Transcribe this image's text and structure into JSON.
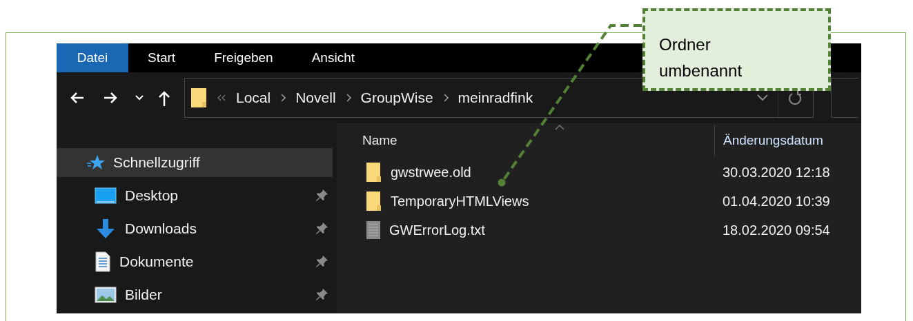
{
  "ribbon_tabs": [
    {
      "label": "Datei",
      "selected": true
    },
    {
      "label": "Start",
      "selected": false
    },
    {
      "label": "Freigeben",
      "selected": false
    },
    {
      "label": "Ansicht",
      "selected": false
    }
  ],
  "address_bar": {
    "path": [
      "Local",
      "Novell",
      "GroupWise",
      "meinradfink"
    ]
  },
  "sidebar": {
    "items": [
      {
        "label": "Schnellzugriff",
        "kind": "quick-access",
        "selected": true,
        "pinned": false
      },
      {
        "label": "Desktop",
        "kind": "desktop",
        "selected": false,
        "pinned": true
      },
      {
        "label": "Downloads",
        "kind": "downloads",
        "selected": false,
        "pinned": true
      },
      {
        "label": "Dokumente",
        "kind": "documents",
        "selected": false,
        "pinned": true
      },
      {
        "label": "Bilder",
        "kind": "pictures",
        "selected": false,
        "pinned": true
      }
    ]
  },
  "file_list": {
    "columns": [
      "Name",
      "Änderungsdatum"
    ],
    "rows": [
      {
        "name": "gwstrwee.old",
        "kind": "folder",
        "modified": "30.03.2020 12:18"
      },
      {
        "name": "TemporaryHTMLViews",
        "kind": "folder",
        "modified": "01.04.2020 10:39"
      },
      {
        "name": "GWErrorLog.txt",
        "kind": "text-file",
        "modified": "18.02.2020 09:54"
      }
    ]
  },
  "callout": {
    "text": "Ordner umbenannt"
  }
}
